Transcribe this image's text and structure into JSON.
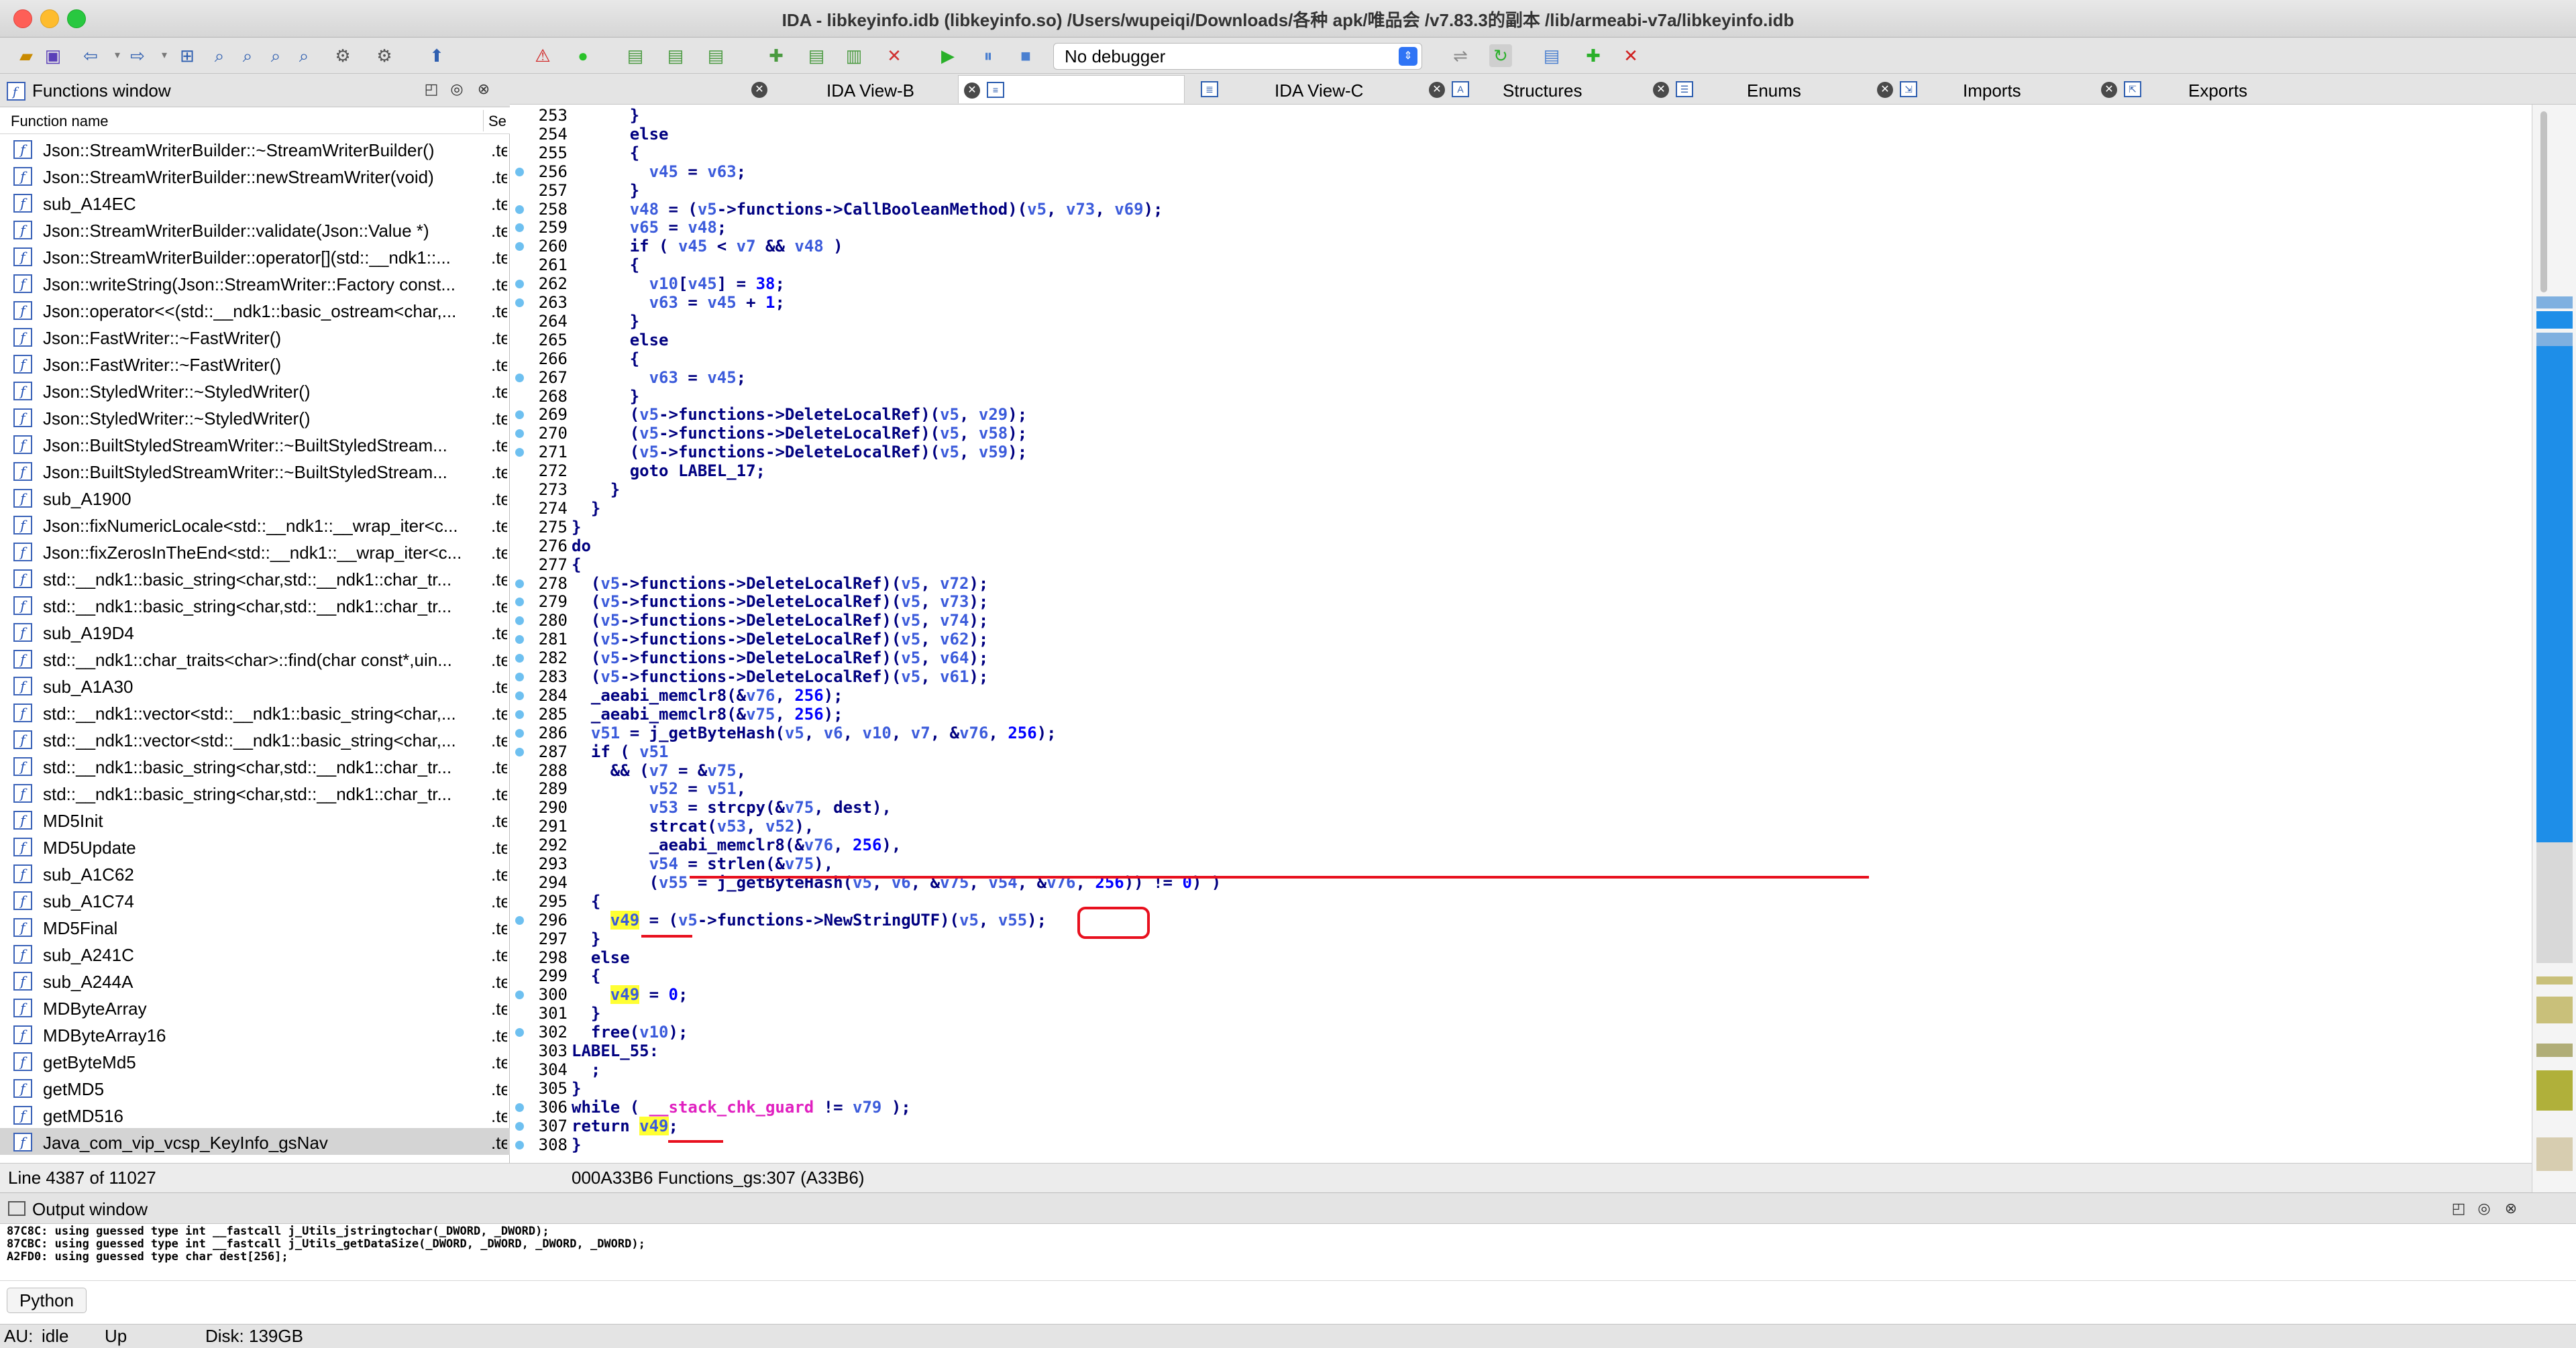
{
  "window": {
    "title": "IDA - libkeyinfo.idb (libkeyinfo.so) /Users/wupeiqi/Downloads/各种 apk/唯品会 /v7.83.3的副本 /lib/armeabi-v7a/libkeyinfo.idb"
  },
  "toolbar": {
    "debugger": "No debugger"
  },
  "functions_window": {
    "title": "Functions window",
    "col_name": "Function name",
    "col_segment": "Se",
    "status": "Line 4387 of 11027",
    "functions": [
      {
        "name": "Json::StreamWriterBuilder::~StreamWriterBuilder()",
        "seg": ".te"
      },
      {
        "name": "Json::StreamWriterBuilder::newStreamWriter(void)",
        "seg": ".te"
      },
      {
        "name": "sub_A14EC",
        "seg": ".te"
      },
      {
        "name": "Json::StreamWriterBuilder::validate(Json::Value *)",
        "seg": ".te"
      },
      {
        "name": "Json::StreamWriterBuilder::operator[](std::__ndk1::...",
        "seg": ".te"
      },
      {
        "name": "Json::writeString(Json::StreamWriter::Factory const...",
        "seg": ".te"
      },
      {
        "name": "Json::operator<<(std::__ndk1::basic_ostream<char,...",
        "seg": ".te"
      },
      {
        "name": "Json::FastWriter::~FastWriter()",
        "seg": ".te"
      },
      {
        "name": "Json::FastWriter::~FastWriter()",
        "seg": ".te"
      },
      {
        "name": "Json::StyledWriter::~StyledWriter()",
        "seg": ".te"
      },
      {
        "name": "Json::StyledWriter::~StyledWriter()",
        "seg": ".te"
      },
      {
        "name": "Json::BuiltStyledStreamWriter::~BuiltStyledStream...",
        "seg": ".te"
      },
      {
        "name": "Json::BuiltStyledStreamWriter::~BuiltStyledStream...",
        "seg": ".te"
      },
      {
        "name": "sub_A1900",
        "seg": ".te"
      },
      {
        "name": "Json::fixNumericLocale<std::__ndk1::__wrap_iter<c...",
        "seg": ".te"
      },
      {
        "name": "Json::fixZerosInTheEnd<std::__ndk1::__wrap_iter<c...",
        "seg": ".te"
      },
      {
        "name": "std::__ndk1::basic_string<char,std::__ndk1::char_tr...",
        "seg": ".te"
      },
      {
        "name": "std::__ndk1::basic_string<char,std::__ndk1::char_tr...",
        "seg": ".te"
      },
      {
        "name": "sub_A19D4",
        "seg": ".te"
      },
      {
        "name": "std::__ndk1::char_traits<char>::find(char const*,uin...",
        "seg": ".te"
      },
      {
        "name": "sub_A1A30",
        "seg": ".te"
      },
      {
        "name": "std::__ndk1::vector<std::__ndk1::basic_string<char,...",
        "seg": ".te"
      },
      {
        "name": "std::__ndk1::vector<std::__ndk1::basic_string<char,...",
        "seg": ".te"
      },
      {
        "name": "std::__ndk1::basic_string<char,std::__ndk1::char_tr...",
        "seg": ".te"
      },
      {
        "name": "std::__ndk1::basic_string<char,std::__ndk1::char_tr...",
        "seg": ".te"
      },
      {
        "name": "MD5Init",
        "seg": ".te"
      },
      {
        "name": "MD5Update",
        "seg": ".te"
      },
      {
        "name": "sub_A1C62",
        "seg": ".te"
      },
      {
        "name": "sub_A1C74",
        "seg": ".te"
      },
      {
        "name": "MD5Final",
        "seg": ".te"
      },
      {
        "name": "sub_A241C",
        "seg": ".te"
      },
      {
        "name": "sub_A244A",
        "seg": ".te"
      },
      {
        "name": "MDByteArray",
        "seg": ".te"
      },
      {
        "name": "MDByteArray16",
        "seg": ".te"
      },
      {
        "name": "getByteMd5",
        "seg": ".te"
      },
      {
        "name": "getMD5",
        "seg": ".te"
      },
      {
        "name": "getMD516",
        "seg": ".te"
      },
      {
        "name": "Java_com_vip_vcsp_KeyInfo_gsNav",
        "seg": ".te"
      }
    ]
  },
  "tabs": [
    {
      "label": "IDA View-B",
      "icon": "graph-icon"
    },
    {
      "label": "",
      "icon": "pseudocode-icon",
      "active": true
    },
    {
      "label": "IDA View-C",
      "icon": "graph-icon"
    },
    {
      "label": "Structures",
      "icon": "structures-icon"
    },
    {
      "label": "Enums",
      "icon": "enums-icon"
    },
    {
      "label": "Imports",
      "icon": "imports-icon"
    },
    {
      "label": "Exports",
      "icon": "exports-icon"
    }
  ],
  "code": {
    "status": "000A33B6 Functions_gs:307 (A33B6)",
    "lines": [
      {
        "n": "253",
        "t": "      }"
      },
      {
        "n": "254",
        "t": "      else"
      },
      {
        "n": "255",
        "t": "      {"
      },
      {
        "n": "256",
        "t": "        v45 = v63;",
        "dot": true
      },
      {
        "n": "257",
        "t": "      }"
      },
      {
        "n": "258",
        "t": "      v48 = (v5->functions->CallBooleanMethod)(v5, v73, v69);",
        "dot": true
      },
      {
        "n": "259",
        "t": "      v65 = v48;",
        "dot": true
      },
      {
        "n": "260",
        "t": "      if ( v45 < v7 && v48 )",
        "dot": true
      },
      {
        "n": "261",
        "t": "      {"
      },
      {
        "n": "262",
        "t": "        v10[v45] = 38;",
        "dot": true
      },
      {
        "n": "263",
        "t": "        v63 = v45 + 1;",
        "dot": true
      },
      {
        "n": "264",
        "t": "      }"
      },
      {
        "n": "265",
        "t": "      else"
      },
      {
        "n": "266",
        "t": "      {"
      },
      {
        "n": "267",
        "t": "        v63 = v45;",
        "dot": true
      },
      {
        "n": "268",
        "t": "      }"
      },
      {
        "n": "269",
        "t": "      (v5->functions->DeleteLocalRef)(v5, v29);",
        "dot": true
      },
      {
        "n": "270",
        "t": "      (v5->functions->DeleteLocalRef)(v5, v58);",
        "dot": true
      },
      {
        "n": "271",
        "t": "      (v5->functions->DeleteLocalRef)(v5, v59);",
        "dot": true
      },
      {
        "n": "272",
        "t": "      goto LABEL_17;"
      },
      {
        "n": "273",
        "t": "    }"
      },
      {
        "n": "274",
        "t": "  }"
      },
      {
        "n": "275",
        "t": "}"
      },
      {
        "n": "276",
        "t": "do"
      },
      {
        "n": "277",
        "t": "{"
      },
      {
        "n": "278",
        "t": "  (v5->functions->DeleteLocalRef)(v5, v72);",
        "dot": true
      },
      {
        "n": "279",
        "t": "  (v5->functions->DeleteLocalRef)(v5, v73);",
        "dot": true
      },
      {
        "n": "280",
        "t": "  (v5->functions->DeleteLocalRef)(v5, v74);",
        "dot": true
      },
      {
        "n": "281",
        "t": "  (v5->functions->DeleteLocalRef)(v5, v62);",
        "dot": true
      },
      {
        "n": "282",
        "t": "  (v5->functions->DeleteLocalRef)(v5, v64);",
        "dot": true
      },
      {
        "n": "283",
        "t": "  (v5->functions->DeleteLocalRef)(v5, v61);",
        "dot": true
      },
      {
        "n": "284",
        "t": "  _aeabi_memclr8(&v76, 256);",
        "dot": true
      },
      {
        "n": "285",
        "t": "  _aeabi_memclr8(&v75, 256);",
        "dot": true
      },
      {
        "n": "286",
        "t": "  v51 = j_getByteHash(v5, v6, v10, v7, &v76, 256);",
        "dot": true
      },
      {
        "n": "287",
        "t": "  if ( v51",
        "dot": true
      },
      {
        "n": "288",
        "t": "    && (v7 = &v75,"
      },
      {
        "n": "289",
        "t": "        v52 = v51,"
      },
      {
        "n": "290",
        "t": "        v53 = strcpy(&v75, dest),"
      },
      {
        "n": "291",
        "t": "        strcat(v53, v52),"
      },
      {
        "n": "292",
        "t": "        _aeabi_memclr8(&v76, 256),"
      },
      {
        "n": "293",
        "t": "        v54 = strlen(&v75),"
      },
      {
        "n": "294",
        "t": "        (v55 = j_getByteHash(v5, v6, &v75, v54, &v76, 256)) != 0) )"
      },
      {
        "n": "295",
        "t": "  {"
      },
      {
        "n": "296",
        "t": "    v49 = (v5->functions->NewStringUTF)(v5, v55);",
        "dot": true
      },
      {
        "n": "297",
        "t": "  }"
      },
      {
        "n": "298",
        "t": "  else"
      },
      {
        "n": "299",
        "t": "  {"
      },
      {
        "n": "300",
        "t": "    v49 = 0;",
        "dot": true
      },
      {
        "n": "301",
        "t": "  }"
      },
      {
        "n": "302",
        "t": "  free(v10);",
        "dot": true
      },
      {
        "n": "303",
        "t": "LABEL_55:"
      },
      {
        "n": "304",
        "t": "  ;"
      },
      {
        "n": "305",
        "t": "}"
      },
      {
        "n": "306",
        "t": "while ( __stack_chk_guard != v79 );",
        "dot": true
      },
      {
        "n": "307",
        "t": "return v49;",
        "dot": true
      },
      {
        "n": "308",
        "t": "}",
        "dot": true
      }
    ]
  },
  "output_window": {
    "title": "Output window",
    "lines": [
      "87C8C: using guessed type int __fastcall j_Utils_jstringtochar(_DWORD, _DWORD);",
      "87CBC: using guessed type int __fastcall j_Utils_getDataSize(_DWORD, _DWORD, _DWORD, _DWORD);",
      "A2FD0: using guessed type char dest[256];"
    ],
    "python_label": "Python"
  },
  "statusbar": {
    "au": "AU:",
    "state": "idle",
    "direction": "Up",
    "disk": "Disk: 139GB"
  },
  "colors": {
    "annotation": "#e8101e",
    "highlight": "#ffff33",
    "keyword": "#000080",
    "variable": "#3b5bdb",
    "global": "#e020c0"
  }
}
